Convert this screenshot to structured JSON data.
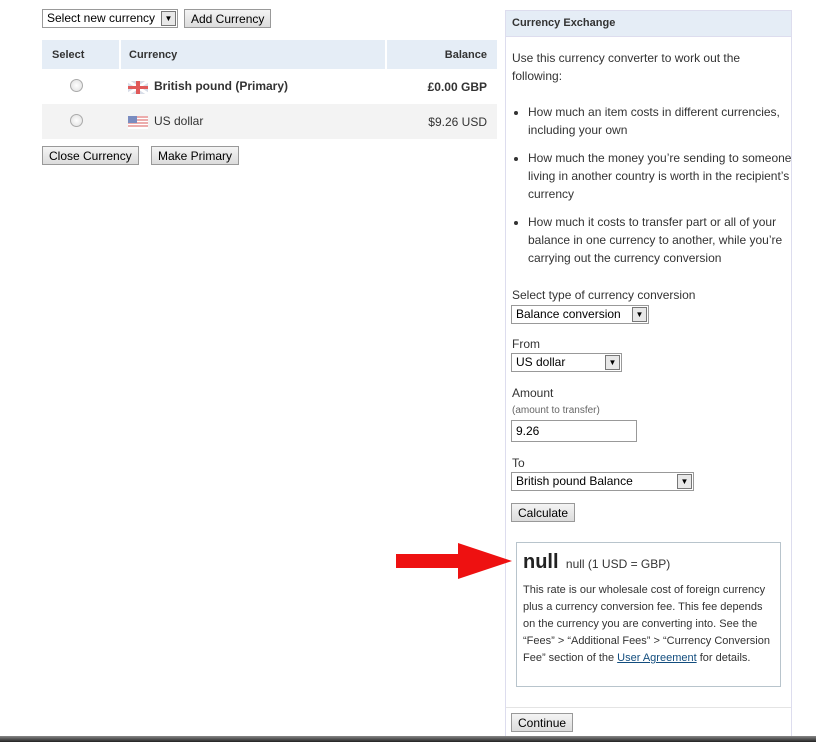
{
  "top": {
    "select_currency": "Select new currency",
    "add_button": "Add Currency"
  },
  "table": {
    "headers": [
      "Select",
      "Currency",
      "Balance"
    ],
    "rows": [
      {
        "currency": "British pound (Primary)",
        "balance": "£0.00 GBP",
        "flag": "uk-flag-icon"
      },
      {
        "currency": "US dollar",
        "balance": "$9.26 USD",
        "flag": "us-flag-icon"
      }
    ]
  },
  "actions": {
    "close": "Close Currency",
    "primary": "Make Primary"
  },
  "panel": {
    "title": "Currency Exchange",
    "intro": "Use this currency converter to work out the following:",
    "bullets": [
      "How much an item costs in different currencies, including your own",
      "How much the money you’re sending to someone living in another country is worth in the recipient’s currency",
      "How much it costs to transfer part or all of your balance in one currency to another, while you’re carrying out the currency conversion"
    ],
    "type_label": "Select type of currency conversion",
    "type_value": "Balance conversion",
    "from_label": "From",
    "from_value": "US dollar",
    "amount_label": "Amount",
    "amount_hint": "(amount to transfer)",
    "amount_value": "9.26",
    "to_label": "To",
    "to_value": "British pound Balance",
    "calculate": "Calculate",
    "result_value": "null",
    "result_rate": "null (1 USD =   GBP)",
    "result_text": "This rate is our wholesale cost of foreign currency plus a currency conversion fee. This fee depends on the currency you are converting into. See the “Fees” > “Additional Fees” > “Currency Conversion Fee” section of the ",
    "link": "User Agreement",
    "result_tail": " for details.",
    "continue": "Continue"
  },
  "annotation": {
    "arrow_color": "#ee1111"
  }
}
